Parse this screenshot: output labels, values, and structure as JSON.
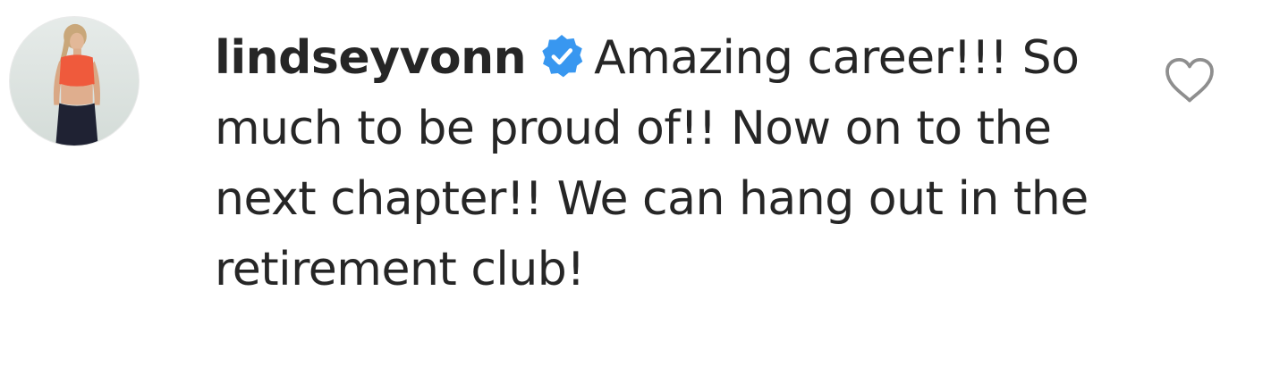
{
  "comment": {
    "username": "lindseyvonn",
    "verified": true,
    "text": "Amazing career!!! So much to be proud of!! Now on to the next chapter!! We can hang out in the retirement club!"
  },
  "icons": {
    "verified": "verified-badge-icon",
    "like": "heart-outline-icon"
  },
  "colors": {
    "text": "#262626",
    "verified_badge": "#3897f0",
    "heart_outline": "#8e8e8e",
    "background": "#ffffff"
  }
}
